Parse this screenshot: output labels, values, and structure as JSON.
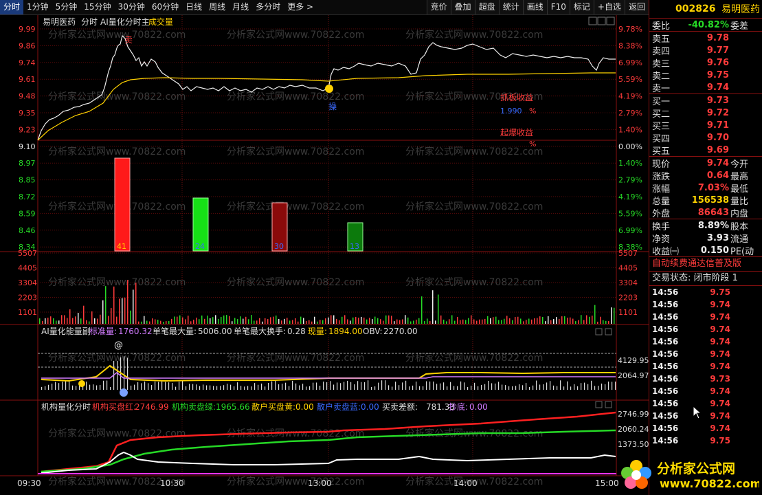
{
  "tabs": [
    "分时",
    "1分钟",
    "5分钟",
    "15分钟",
    "30分钟",
    "60分钟",
    "日线",
    "周线",
    "月线",
    "多分时",
    "更多 >"
  ],
  "active_tab": 0,
  "tools": [
    "竞价",
    "叠加",
    "超盘",
    "统计",
    "画线",
    "F10",
    "标记",
    "+自选",
    "返回"
  ],
  "main": {
    "title_name": "易明医药",
    "title_mode": "分时",
    "title_indicator": "AI量化分时主",
    "title_volume": "成交量",
    "price_labels": [
      "9.99",
      "9.86",
      "9.74",
      "9.61",
      "9.48",
      "9.35",
      "9.23",
      "9.10",
      "8.97",
      "8.85",
      "8.72",
      "8.59",
      "8.46",
      "8.34"
    ],
    "pct_labels": [
      "9.78%",
      "8.38%",
      "6.99%",
      "5.59%",
      "4.19%",
      "2.79%",
      "1.40%",
      "0.00%",
      "1.40%",
      "2.79%",
      "4.19%",
      "5.59%",
      "6.99%",
      "8.38%"
    ],
    "sell_mark": "卖",
    "buy_mark": "操",
    "ann1_label": "抓板收益",
    "ann1_value": "1.990",
    "ann1_unit": "%",
    "ann2_label": "起爆收益",
    "ann2_unit": "%",
    "bar_labels": [
      "41",
      "24",
      "30",
      "13"
    ]
  },
  "volume_axis": [
    "5507",
    "4405",
    "3304",
    "2203",
    "1101"
  ],
  "energy": {
    "title": "AI量化能量副",
    "std_label": "标准量:",
    "std_value": "1760.32",
    "max_vol_label": "单笔最大量:",
    "max_vol_value": "5006.00",
    "max_turn_label": "单笔最大换手:",
    "max_turn_value": "0.28",
    "cur_label": "现量:",
    "cur_value": "1894.00",
    "obv_label": "OBV:",
    "obv_value": "2270.00",
    "axis": [
      "4129.95",
      "2064.97"
    ],
    "at_mark": "@"
  },
  "inst": {
    "title": "机构量化分时",
    "red_label": "机构买盘红:",
    "red_value": "2746.99",
    "green_label": "机构卖盘绿:",
    "green_value": "1965.66",
    "yellow_label": "散户买盘黄:",
    "yellow_value": "0.00",
    "blue_label": "散户卖盘蓝:",
    "blue_value": "0.00",
    "diff_label": "买卖差额:",
    "diff_value": "781.33",
    "bottom_label": "抄底:",
    "bottom_value": "0.00",
    "axis": [
      "2746.99",
      "2060.24",
      "1373.50"
    ]
  },
  "time_labels": [
    "09:30",
    "10:30",
    "13:00",
    "14:00",
    "15:00"
  ],
  "watermark": "分析家公式网www.70822.com",
  "side": {
    "code": "002826",
    "name": "易明医药",
    "wb_label": "委比",
    "wb_value": "-40.82%",
    "wb_label2": "委差",
    "asks": [
      {
        "label": "卖五",
        "price": "9.78"
      },
      {
        "label": "卖四",
        "price": "9.77"
      },
      {
        "label": "卖三",
        "price": "9.76"
      },
      {
        "label": "卖二",
        "price": "9.75"
      },
      {
        "label": "卖一",
        "price": "9.74"
      }
    ],
    "bids": [
      {
        "label": "买一",
        "price": "9.73"
      },
      {
        "label": "买二",
        "price": "9.72"
      },
      {
        "label": "买三",
        "price": "9.71"
      },
      {
        "label": "买四",
        "price": "9.70"
      },
      {
        "label": "买五",
        "price": "9.69"
      }
    ],
    "stats1": [
      {
        "label": "现价",
        "value": "9.74",
        "label2": "今开",
        "color": "red"
      },
      {
        "label": "涨跌",
        "value": "0.64",
        "label2": "最高",
        "color": "red"
      },
      {
        "label": "涨幅",
        "value": "7.03%",
        "label2": "最低",
        "color": "red"
      },
      {
        "label": "总量",
        "value": "156538",
        "label2": "量比",
        "color": "yellow"
      },
      {
        "label": "外盘",
        "value": "86643",
        "label2": "内盘",
        "color": "red"
      }
    ],
    "stats2": [
      {
        "label": "换手",
        "value": "8.89%",
        "label2": "股本",
        "color": "white"
      },
      {
        "label": "净资",
        "value": "3.93",
        "label2": "流通",
        "color": "white"
      },
      {
        "label": "收益㈠",
        "value": "0.150",
        "label2": "PE(动",
        "color": "white"
      }
    ],
    "banner": "自动续费通达信普及版",
    "status": "交易状态: 闭市阶段 1",
    "ticks": [
      {
        "t": "14:56",
        "p": "9.75"
      },
      {
        "t": "14:56",
        "p": "9.74"
      },
      {
        "t": "14:56",
        "p": "9.74"
      },
      {
        "t": "14:56",
        "p": "9.74"
      },
      {
        "t": "14:56",
        "p": "9.74"
      },
      {
        "t": "14:56",
        "p": "9.74"
      },
      {
        "t": "14:56",
        "p": "9.74"
      },
      {
        "t": "14:56",
        "p": "9.73"
      },
      {
        "t": "14:56",
        "p": "9.74"
      },
      {
        "t": "14:56",
        "p": "9.74"
      },
      {
        "t": "14:56",
        "p": "9.74"
      },
      {
        "t": "14:56",
        "p": "9.74"
      },
      {
        "t": "14:56",
        "p": "9.75"
      }
    ]
  },
  "logo": {
    "title": "分析家公式网",
    "url": "www.70822.com"
  }
}
